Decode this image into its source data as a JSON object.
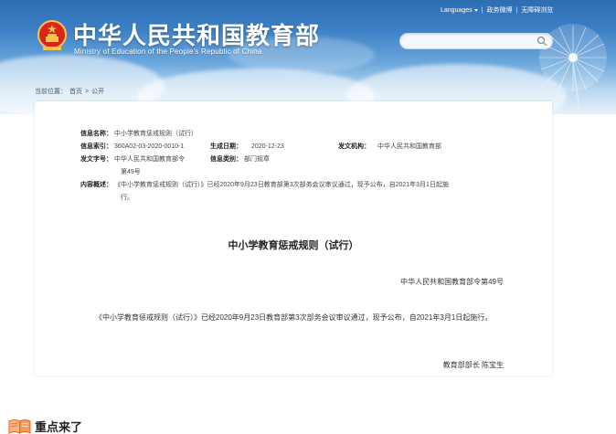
{
  "header": {
    "site_title": "中华人民共和国教育部",
    "site_subtitle": "Ministry of Education of the People's Republic of China",
    "top_links": [
      "Languages",
      "政务微博",
      "无障碍浏览"
    ],
    "search_placeholder": "",
    "brand_color": "#2f6db3"
  },
  "breadcrumb": [
    "当前位置：",
    "首页",
    ">",
    "公开"
  ],
  "meta": {
    "info_name_label": "信息名称：",
    "info_name_value": "中小学教育惩戒规则（试行）",
    "info_index_label": "信息索引：",
    "info_index_value": "360A02-03-2020-0010-1",
    "gen_date_label": "生成日期：",
    "gen_date_value": "2020-12-23",
    "issuer_label": "发文机构：",
    "issuer_value": "中华人民共和国教育部",
    "doc_no_label": "发文字号：",
    "doc_no_value_1": "中华人民共和国教育部令",
    "doc_no_value_2": "第49号",
    "category_label": "信息类别：",
    "category_value": "部门规章",
    "summary_label": "内容概述：",
    "summary_value_1": "《中小学教育惩戒规则（试行）》已经2020年9月23日教育部第3次部务会议审议通过，现予公布，自2021年3月1日起施",
    "summary_value_2": "行。"
  },
  "document": {
    "title": "中小学教育惩戒规则（试行）",
    "order_no": "中华人民共和国教育部令第49号",
    "body": "《中小学教育惩戒规则（试行）》已经2020年9月23日教育部第3次部务会议审议通过，现予公布，自2021年3月1日起施行。",
    "signer": "教育部部长 陈宝生"
  },
  "highlight": {
    "text": "重点来了",
    "icon": "book-icon",
    "icon_color": "#e8632b"
  }
}
